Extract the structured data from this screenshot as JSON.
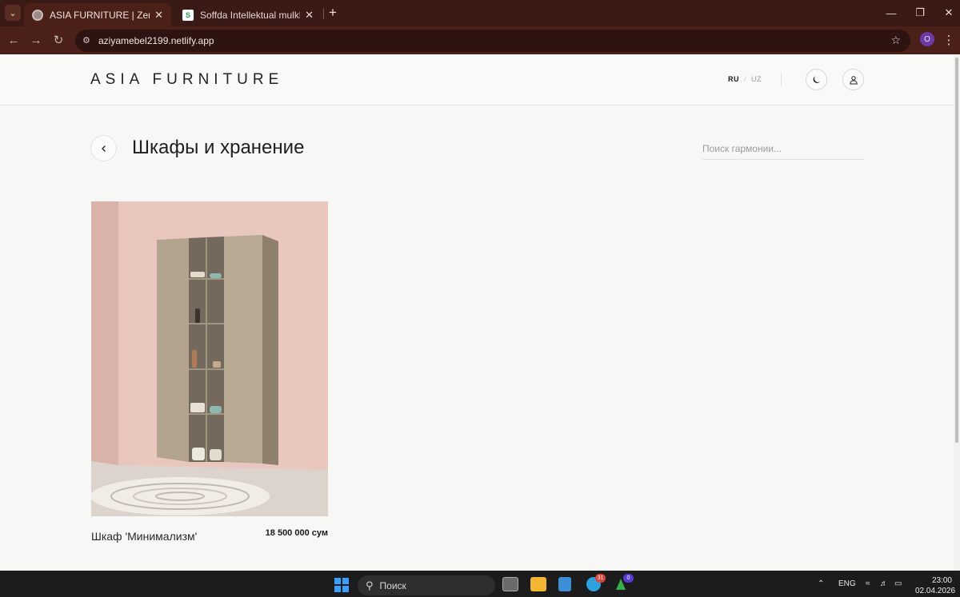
{
  "browser": {
    "tabs": [
      {
        "title": "ASIA FURNITURE | Zen Living",
        "active": true
      },
      {
        "title": "Soffda Intellektual mulklaringiz",
        "active": false
      }
    ],
    "url": "aziyamebel2199.netlify.app",
    "profile_initial": "O"
  },
  "header": {
    "logo": "ASIA FURNITURE",
    "lang_ru": "RU",
    "lang_sep": "/",
    "lang_uz": "UZ"
  },
  "page": {
    "title": "Шкафы и хранение",
    "search_placeholder": "Поиск гармонии..."
  },
  "products": [
    {
      "name": "Шкаф 'Минимализм'",
      "price": "18 500 000 сум"
    }
  ],
  "taskbar": {
    "search_label": "Поиск",
    "telegram_badge": "31",
    "app_badge": "0",
    "language": "ENG",
    "time": "23:00",
    "date": "02.04.2026"
  }
}
